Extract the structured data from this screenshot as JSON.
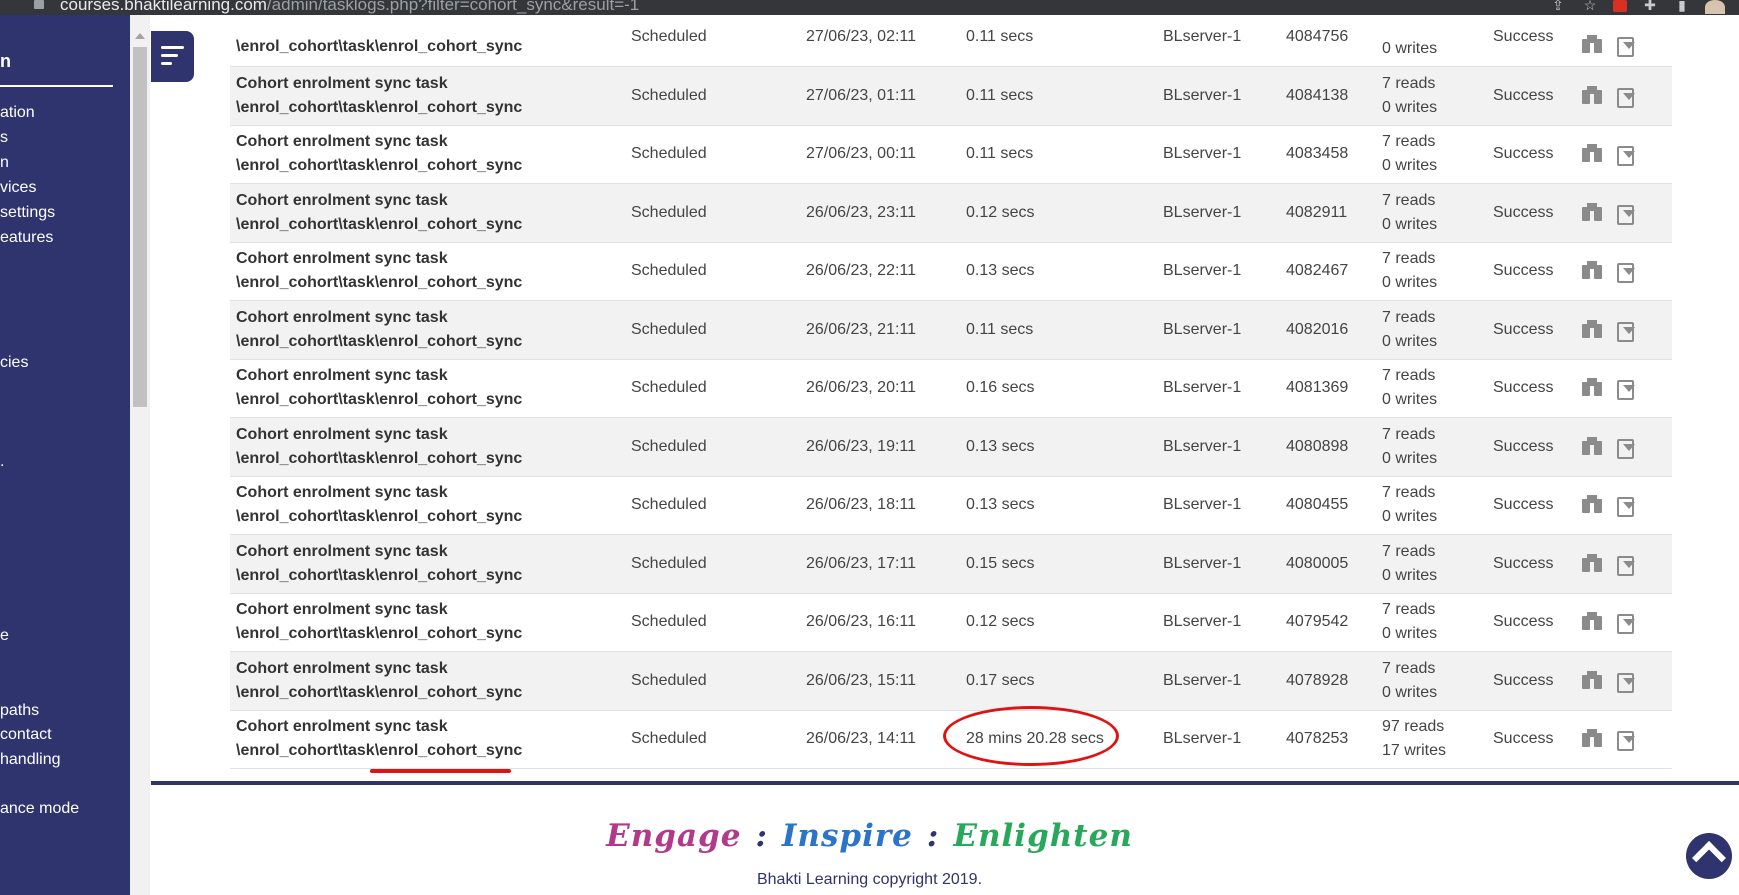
{
  "browser": {
    "url_host": "courses.bhaktilearning.com",
    "url_path": "/admin/tasklogs.php?filter=cohort_sync&result=-1"
  },
  "sidebar": {
    "title": "n",
    "items": [
      {
        "label": "ation"
      },
      {
        "label": "s"
      },
      {
        "label": "n"
      },
      {
        "label": "vices"
      },
      {
        "label": "settings"
      },
      {
        "label": "eatures"
      },
      {
        "label": "cies"
      },
      {
        "label": "."
      },
      {
        "label": "e"
      },
      {
        "label": "paths"
      },
      {
        "label": "contact"
      },
      {
        "label": "handling"
      },
      {
        "label": "ance mode"
      }
    ]
  },
  "log_table": {
    "first_row": {
      "name_line2": "\\enrol_cohort\\task\\enrol_cohort_sync",
      "type": "Scheduled",
      "time": "27/06/23, 02:11",
      "duration": "0.11 secs",
      "host": "BLserver-1",
      "pid": "4084756",
      "writes": "0 writes",
      "result": "Success"
    },
    "rows": [
      {
        "name": "Cohort enrolment sync task",
        "classname": "\\enrol_cohort\\task\\enrol_cohort_sync",
        "type": "Scheduled",
        "time": "27/06/23, 01:11",
        "duration": "0.11 secs",
        "host": "BLserver-1",
        "pid": "4084138",
        "reads": "7 reads",
        "writes": "0 writes",
        "result": "Success"
      },
      {
        "name": "Cohort enrolment sync task",
        "classname": "\\enrol_cohort\\task\\enrol_cohort_sync",
        "type": "Scheduled",
        "time": "27/06/23, 00:11",
        "duration": "0.11 secs",
        "host": "BLserver-1",
        "pid": "4083458",
        "reads": "7 reads",
        "writes": "0 writes",
        "result": "Success"
      },
      {
        "name": "Cohort enrolment sync task",
        "classname": "\\enrol_cohort\\task\\enrol_cohort_sync",
        "type": "Scheduled",
        "time": "26/06/23, 23:11",
        "duration": "0.12 secs",
        "host": "BLserver-1",
        "pid": "4082911",
        "reads": "7 reads",
        "writes": "0 writes",
        "result": "Success"
      },
      {
        "name": "Cohort enrolment sync task",
        "classname": "\\enrol_cohort\\task\\enrol_cohort_sync",
        "type": "Scheduled",
        "time": "26/06/23, 22:11",
        "duration": "0.13 secs",
        "host": "BLserver-1",
        "pid": "4082467",
        "reads": "7 reads",
        "writes": "0 writes",
        "result": "Success"
      },
      {
        "name": "Cohort enrolment sync task",
        "classname": "\\enrol_cohort\\task\\enrol_cohort_sync",
        "type": "Scheduled",
        "time": "26/06/23, 21:11",
        "duration": "0.11 secs",
        "host": "BLserver-1",
        "pid": "4082016",
        "reads": "7 reads",
        "writes": "0 writes",
        "result": "Success"
      },
      {
        "name": "Cohort enrolment sync task",
        "classname": "\\enrol_cohort\\task\\enrol_cohort_sync",
        "type": "Scheduled",
        "time": "26/06/23, 20:11",
        "duration": "0.16 secs",
        "host": "BLserver-1",
        "pid": "4081369",
        "reads": "7 reads",
        "writes": "0 writes",
        "result": "Success"
      },
      {
        "name": "Cohort enrolment sync task",
        "classname": "\\enrol_cohort\\task\\enrol_cohort_sync",
        "type": "Scheduled",
        "time": "26/06/23, 19:11",
        "duration": "0.13 secs",
        "host": "BLserver-1",
        "pid": "4080898",
        "reads": "7 reads",
        "writes": "0 writes",
        "result": "Success"
      },
      {
        "name": "Cohort enrolment sync task",
        "classname": "\\enrol_cohort\\task\\enrol_cohort_sync",
        "type": "Scheduled",
        "time": "26/06/23, 18:11",
        "duration": "0.13 secs",
        "host": "BLserver-1",
        "pid": "4080455",
        "reads": "7 reads",
        "writes": "0 writes",
        "result": "Success"
      },
      {
        "name": "Cohort enrolment sync task",
        "classname": "\\enrol_cohort\\task\\enrol_cohort_sync",
        "type": "Scheduled",
        "time": "26/06/23, 17:11",
        "duration": "0.15 secs",
        "host": "BLserver-1",
        "pid": "4080005",
        "reads": "7 reads",
        "writes": "0 writes",
        "result": "Success"
      },
      {
        "name": "Cohort enrolment sync task",
        "classname": "\\enrol_cohort\\task\\enrol_cohort_sync",
        "type": "Scheduled",
        "time": "26/06/23, 16:11",
        "duration": "0.12 secs",
        "host": "BLserver-1",
        "pid": "4079542",
        "reads": "7 reads",
        "writes": "0 writes",
        "result": "Success"
      },
      {
        "name": "Cohort enrolment sync task",
        "classname": "\\enrol_cohort\\task\\enrol_cohort_sync",
        "type": "Scheduled",
        "time": "26/06/23, 15:11",
        "duration": "0.17 secs",
        "host": "BLserver-1",
        "pid": "4078928",
        "reads": "7 reads",
        "writes": "0 writes",
        "result": "Success"
      },
      {
        "name": "Cohort enrolment sync task",
        "classname": "\\enrol_cohort\\task\\enrol_cohort_sync",
        "type": "Scheduled",
        "time": "26/06/23, 14:11",
        "duration": "28 mins 20.28 secs",
        "host": "BLserver-1",
        "pid": "4078253",
        "reads": "97 reads",
        "writes": "17 writes",
        "result": "Success"
      }
    ]
  },
  "footer": {
    "tagline": {
      "word1": "Engage",
      "sep": ":",
      "word2": "Inspire",
      "word3": "Enlighten"
    },
    "copyright": "Bhakti Learning copyright 2019."
  },
  "colors": {
    "brand": "#2f336e",
    "annotation": "#e01313",
    "tagline_engage": "#b23a8a",
    "tagline_inspire": "#2a74c9",
    "tagline_enlighten": "#27a85a"
  }
}
